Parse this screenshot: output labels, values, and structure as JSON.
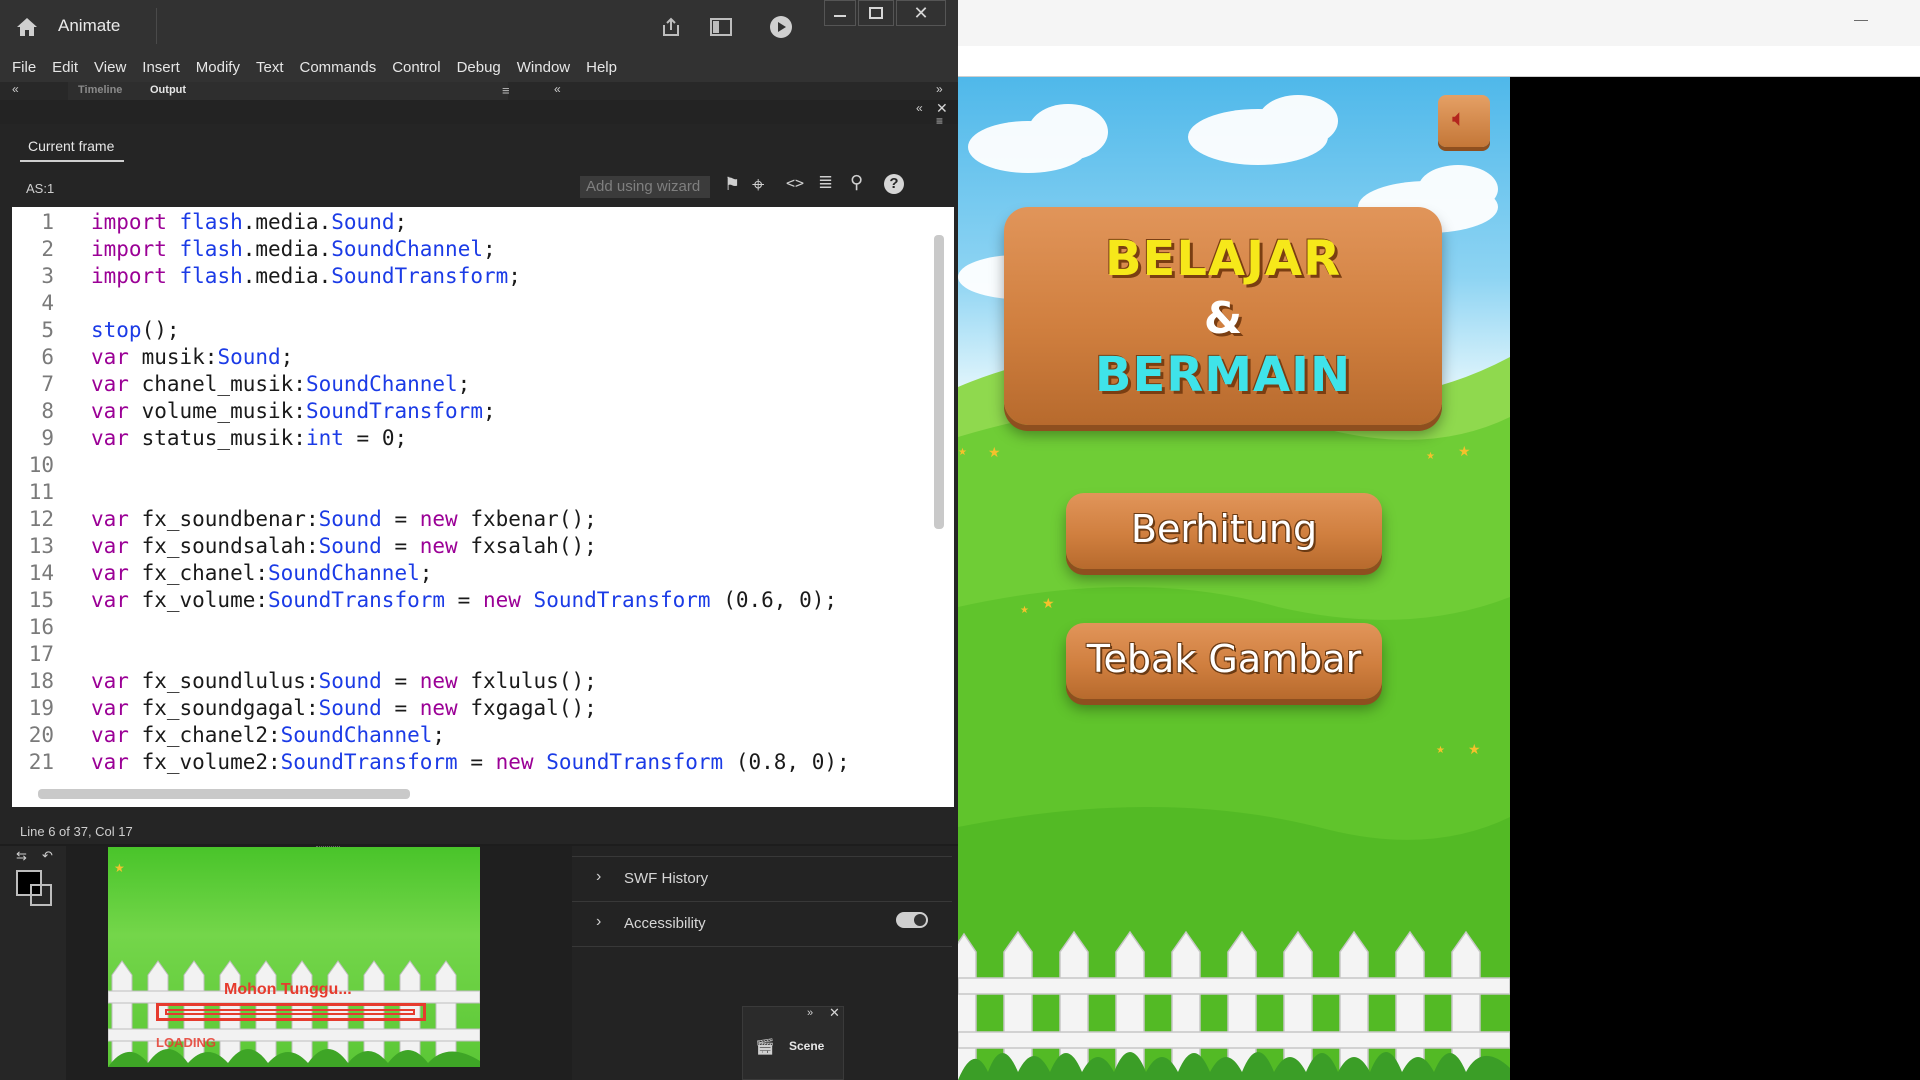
{
  "app": {
    "name": "Animate"
  },
  "titlebar": {
    "icons": [
      "home-icon",
      "share-icon",
      "panel-icon",
      "play-icon",
      "minimize-icon",
      "maximize-icon",
      "close-icon"
    ]
  },
  "menu": [
    "File",
    "Edit",
    "View",
    "Insert",
    "Modify",
    "Text",
    "Commands",
    "Control",
    "Debug",
    "Window",
    "Help"
  ],
  "tabs": {
    "timeline": "Timeline",
    "output": "Output"
  },
  "actions_panel": {
    "current_frame_tab": "Current frame",
    "target": "AS:1",
    "wizard_placeholder": "Add using wizard",
    "status": "Line 6 of 37, Col 17"
  },
  "code_lines": [
    {
      "n": "1",
      "parts": [
        [
          "kw",
          "import "
        ],
        [
          "ty",
          "flash"
        ],
        [
          "",
          "."
        ],
        [
          "",
          "media"
        ],
        [
          "",
          "."
        ],
        [
          "ty",
          "Sound"
        ],
        [
          "",
          ";"
        ]
      ]
    },
    {
      "n": "2",
      "parts": [
        [
          "kw",
          "import "
        ],
        [
          "ty",
          "flash"
        ],
        [
          "",
          "."
        ],
        [
          "",
          "media"
        ],
        [
          "",
          "."
        ],
        [
          "ty",
          "SoundChannel"
        ],
        [
          "",
          ";"
        ]
      ]
    },
    {
      "n": "3",
      "parts": [
        [
          "kw",
          "import "
        ],
        [
          "ty",
          "flash"
        ],
        [
          "",
          "."
        ],
        [
          "",
          "media"
        ],
        [
          "",
          "."
        ],
        [
          "ty",
          "SoundTransform"
        ],
        [
          "",
          ";"
        ]
      ]
    },
    {
      "n": "4",
      "parts": []
    },
    {
      "n": "5",
      "parts": [
        [
          "ty",
          "stop"
        ],
        [
          "",
          "();"
        ]
      ]
    },
    {
      "n": "6",
      "parts": [
        [
          "kw",
          "var "
        ],
        [
          "",
          "musik:"
        ],
        [
          "ty",
          "Sound"
        ],
        [
          "",
          ";"
        ]
      ]
    },
    {
      "n": "7",
      "parts": [
        [
          "kw",
          "var "
        ],
        [
          "",
          "chanel_musik:"
        ],
        [
          "ty",
          "SoundChannel"
        ],
        [
          "",
          ";"
        ]
      ]
    },
    {
      "n": "8",
      "parts": [
        [
          "kw",
          "var "
        ],
        [
          "",
          "volume_musik:"
        ],
        [
          "ty",
          "SoundTransform"
        ],
        [
          "",
          ";"
        ]
      ]
    },
    {
      "n": "9",
      "parts": [
        [
          "kw",
          "var "
        ],
        [
          "",
          "status_musik:"
        ],
        [
          "ty",
          "int"
        ],
        [
          "",
          " = 0;"
        ]
      ]
    },
    {
      "n": "10",
      "parts": []
    },
    {
      "n": "11",
      "parts": []
    },
    {
      "n": "12",
      "parts": [
        [
          "kw",
          "var "
        ],
        [
          "",
          "fx_soundbenar:"
        ],
        [
          "ty",
          "Sound"
        ],
        [
          "",
          " = "
        ],
        [
          "kw",
          "new "
        ],
        [
          "",
          "fxbenar();"
        ]
      ]
    },
    {
      "n": "13",
      "parts": [
        [
          "kw",
          "var "
        ],
        [
          "",
          "fx_soundsalah:"
        ],
        [
          "ty",
          "Sound"
        ],
        [
          "",
          " = "
        ],
        [
          "kw",
          "new "
        ],
        [
          "",
          "fxsalah();"
        ]
      ]
    },
    {
      "n": "14",
      "parts": [
        [
          "kw",
          "var "
        ],
        [
          "",
          "fx_chanel:"
        ],
        [
          "ty",
          "SoundChannel"
        ],
        [
          "",
          ";"
        ]
      ]
    },
    {
      "n": "15",
      "parts": [
        [
          "kw",
          "var "
        ],
        [
          "",
          "fx_volume:"
        ],
        [
          "ty",
          "SoundTransform"
        ],
        [
          "",
          " = "
        ],
        [
          "kw",
          "new "
        ],
        [
          "ty",
          "SoundTransform"
        ],
        [
          "",
          " (0.6, 0);"
        ]
      ]
    },
    {
      "n": "16",
      "parts": []
    },
    {
      "n": "17",
      "parts": []
    },
    {
      "n": "18",
      "parts": [
        [
          "kw",
          "var "
        ],
        [
          "",
          "fx_soundlulus:"
        ],
        [
          "ty",
          "Sound"
        ],
        [
          "",
          " = "
        ],
        [
          "kw",
          "new "
        ],
        [
          "",
          "fxlulus();"
        ]
      ]
    },
    {
      "n": "19",
      "parts": [
        [
          "kw",
          "var "
        ],
        [
          "",
          "fx_soundgagal:"
        ],
        [
          "ty",
          "Sound"
        ],
        [
          "",
          " = "
        ],
        [
          "kw",
          "new "
        ],
        [
          "",
          "fxgagal();"
        ]
      ]
    },
    {
      "n": "20",
      "parts": [
        [
          "kw",
          "var "
        ],
        [
          "",
          "fx_chanel2:"
        ],
        [
          "ty",
          "SoundChannel"
        ],
        [
          "",
          ";"
        ]
      ]
    },
    {
      "n": "21",
      "parts": [
        [
          "kw",
          "var "
        ],
        [
          "",
          "fx_volume2:"
        ],
        [
          "ty",
          "SoundTransform"
        ],
        [
          "",
          " = "
        ],
        [
          "kw",
          "new "
        ],
        [
          "ty",
          "SoundTransform"
        ],
        [
          "",
          " (0.8, 0);"
        ]
      ]
    }
  ],
  "stage_preview": {
    "loading_title": "Mohon Tunggu...",
    "loading_label": "LOADING"
  },
  "properties": {
    "swf_history": "SWF History",
    "accessibility": "Accessibility"
  },
  "scene_panel": {
    "label": "Scene"
  },
  "game": {
    "title_line1": "BELAJAR",
    "title_amp": "&",
    "title_line2": "BERMAIN",
    "button1": "Berhitung",
    "button2": "Tebak Gambar",
    "colors": {
      "title1": "#f6e81a",
      "title2": "#3fe3e9"
    }
  }
}
